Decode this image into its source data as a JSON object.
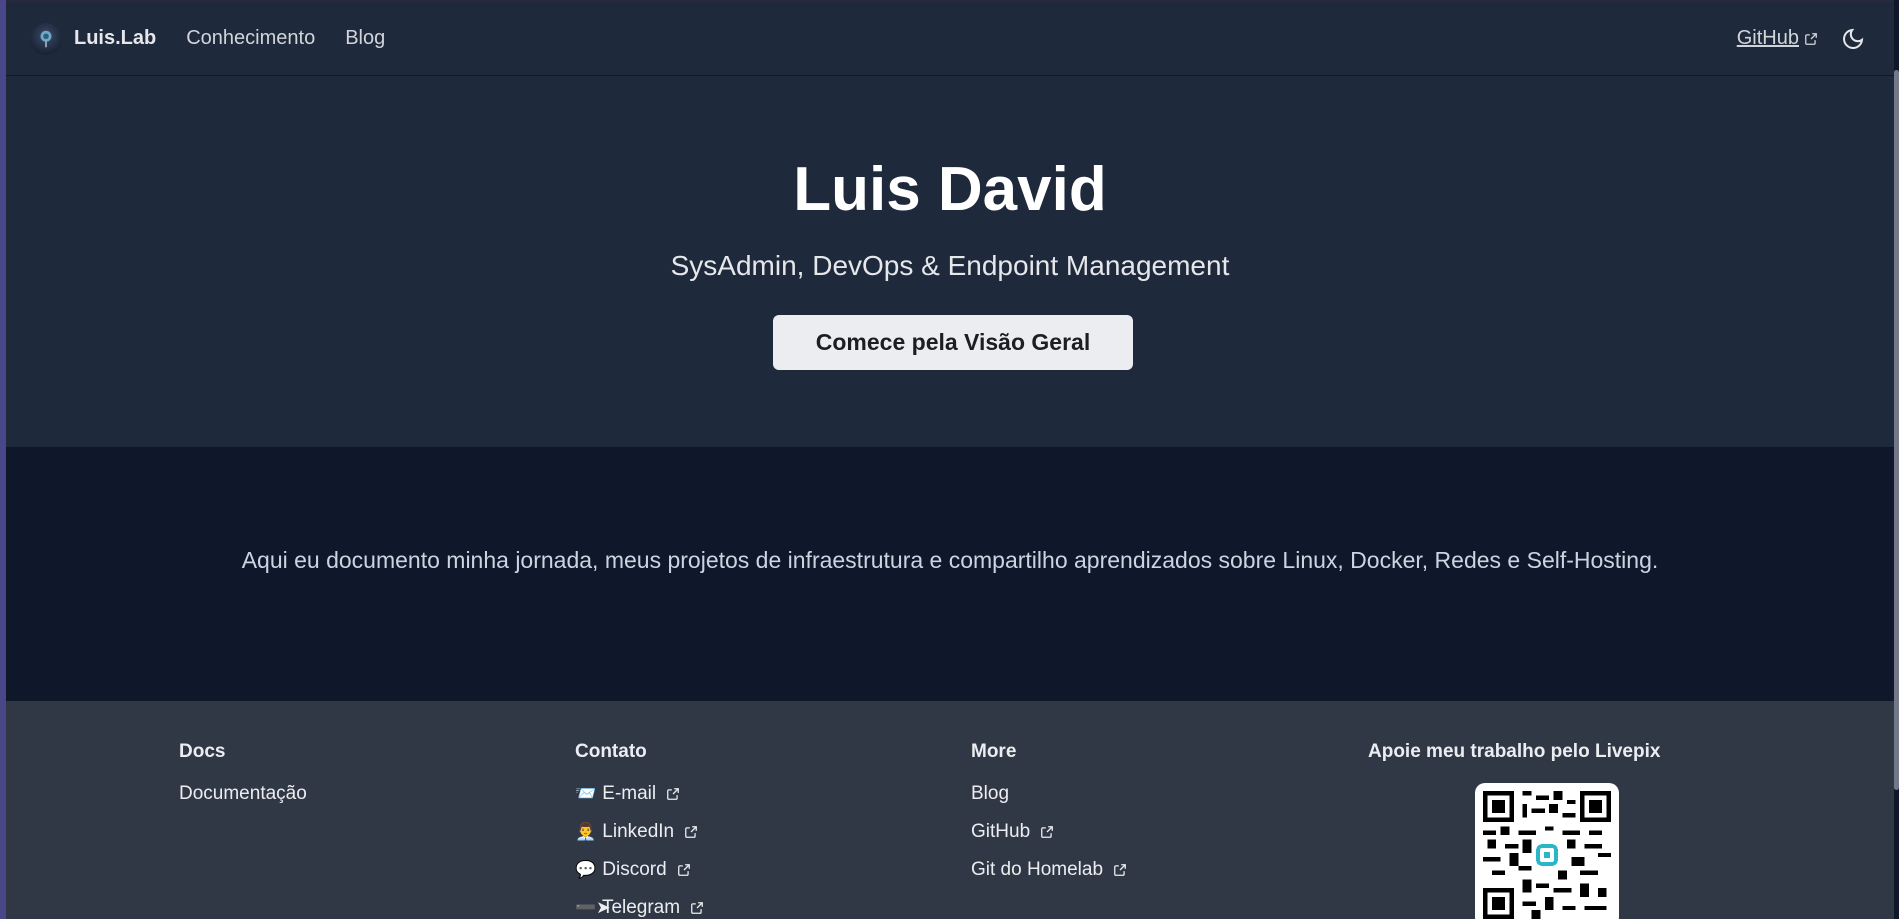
{
  "navbar": {
    "brand": "Luis.Lab",
    "links": [
      "Conhecimento",
      "Blog"
    ],
    "github_label": "GitHub"
  },
  "hero": {
    "title": "Luis David",
    "subtitle": "SysAdmin, DevOps & Endpoint Management",
    "button_label": "Comece pela Visão Geral"
  },
  "intro": {
    "text": "Aqui eu documento minha jornada, meus projetos de infraestrutura e compartilho aprendizados sobre Linux, Docker, Redes e Self-Hosting."
  },
  "footer": {
    "docs": {
      "heading": "Docs",
      "links": [
        "Documentação"
      ]
    },
    "contato": {
      "heading": "Contato",
      "links": [
        {
          "emoji": "📨",
          "label": "E-mail"
        },
        {
          "emoji": "👨‍💼",
          "label": "LinkedIn"
        },
        {
          "emoji": "💬",
          "label": "Discord"
        },
        {
          "emoji": "➖➤",
          "label": "Telegram"
        }
      ]
    },
    "more": {
      "heading": "More",
      "links": [
        "Blog",
        "GitHub",
        "Git do Homelab"
      ]
    },
    "support": {
      "heading": "Apoie meu trabalho pelo Livepix"
    }
  },
  "colors": {
    "navbar_bg": "#1e293b",
    "intro_bg": "#0f172a",
    "footer_bg": "#303846",
    "button_bg": "#ebedf0"
  }
}
